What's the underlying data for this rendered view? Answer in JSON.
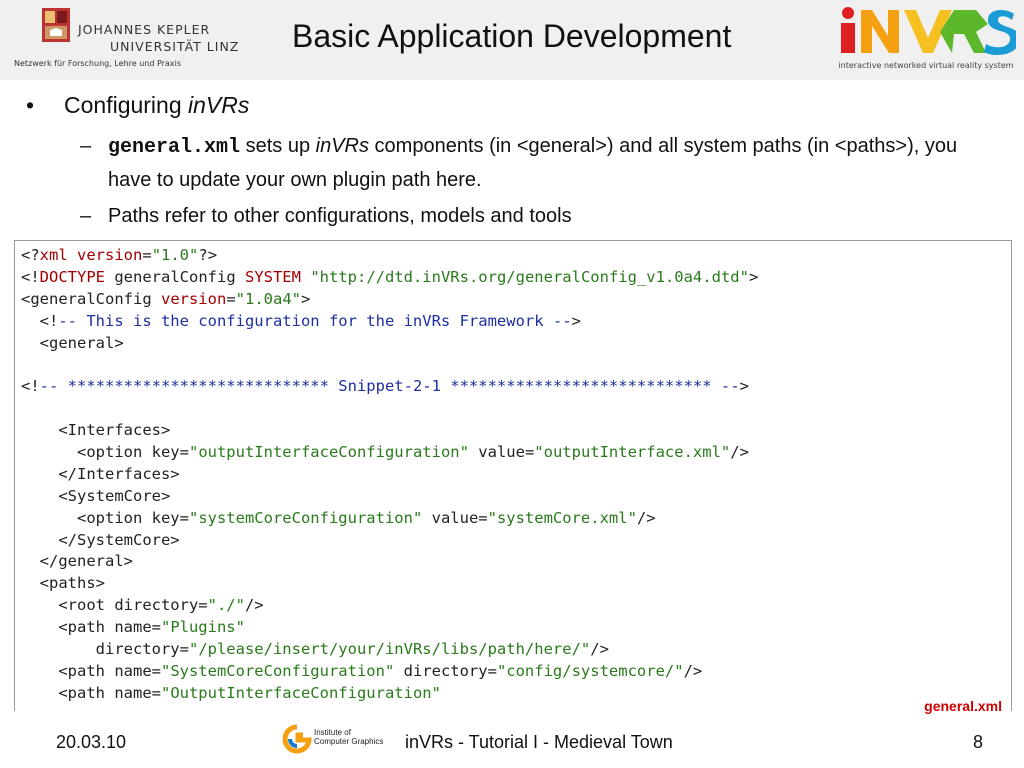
{
  "header": {
    "title": "Basic Application Development",
    "jku_line1": "JOHANNES KEPLER",
    "jku_line2": "UNIVERSITÄT LINZ",
    "jku_subtitle": "Netzwerk für Forschung, Lehre und Praxis",
    "invrs_logo": "iNVRS",
    "invrs_subtitle": "interactive networked virtual reality system"
  },
  "bullets": {
    "main_bullet": "•",
    "main_prefix": "Configuring ",
    "main_emph": "inVRs",
    "sub_dash": "–",
    "sub1": {
      "code": "general.xml",
      "t1": " sets up ",
      "emph": "inVRs",
      "t2": " components (in <general>) and all system paths (in <paths>), you have to update your own plugin path here."
    },
    "sub2": "Paths refer to other configurations, models and tools"
  },
  "code": {
    "lines": [
      [
        {
          "t": "<?"
        },
        {
          "t": "xml",
          "c": "k"
        },
        {
          "t": " "
        },
        {
          "t": "version",
          "c": "k"
        },
        {
          "t": "="
        },
        {
          "t": "\"1.0\"",
          "c": "s"
        },
        {
          "t": "?>"
        }
      ],
      [
        {
          "t": "<!"
        },
        {
          "t": "DOCTYPE",
          "c": "k"
        },
        {
          "t": " generalConfig "
        },
        {
          "t": "SYSTEM",
          "c": "k"
        },
        {
          "t": " "
        },
        {
          "t": "\"http://dtd.inVRs.org/generalConfig_v1.0a4.dtd\"",
          "c": "s"
        },
        {
          "t": ">"
        }
      ],
      [
        {
          "t": "<generalConfig "
        },
        {
          "t": "version",
          "c": "k"
        },
        {
          "t": "="
        },
        {
          "t": "\"1.0a4\"",
          "c": "s"
        },
        {
          "t": ">"
        }
      ],
      [
        {
          "t": "  <!"
        },
        {
          "t": "-- This is the configuration for the inVRs Framework --",
          "c": "c"
        },
        {
          "t": ">"
        }
      ],
      [
        {
          "t": "  <general>"
        }
      ],
      [
        {
          "t": ""
        }
      ],
      [
        {
          "t": "<!"
        },
        {
          "t": "-- **************************** Snippet-2-1 **************************** --",
          "c": "c"
        },
        {
          "t": ">"
        }
      ],
      [
        {
          "t": ""
        }
      ],
      [
        {
          "t": "    <Interfaces>"
        }
      ],
      [
        {
          "t": "      <option key="
        },
        {
          "t": "\"outputInterfaceConfiguration\"",
          "c": "s"
        },
        {
          "t": " value="
        },
        {
          "t": "\"outputInterface.xml\"",
          "c": "s"
        },
        {
          "t": "/>"
        }
      ],
      [
        {
          "t": "    </Interfaces>"
        }
      ],
      [
        {
          "t": "    <SystemCore>"
        }
      ],
      [
        {
          "t": "      <option key="
        },
        {
          "t": "\"systemCoreConfiguration\"",
          "c": "s"
        },
        {
          "t": " value="
        },
        {
          "t": "\"systemCore.xml\"",
          "c": "s"
        },
        {
          "t": "/>"
        }
      ],
      [
        {
          "t": "    </SystemCore>"
        }
      ],
      [
        {
          "t": "  </general>"
        }
      ],
      [
        {
          "t": "  <paths>"
        }
      ],
      [
        {
          "t": "    <root directory="
        },
        {
          "t": "\"./\"",
          "c": "s"
        },
        {
          "t": "/>"
        }
      ],
      [
        {
          "t": "    <path name="
        },
        {
          "t": "\"Plugins\"",
          "c": "s"
        }
      ],
      [
        {
          "t": "        directory="
        },
        {
          "t": "\"/please/insert/your/inVRs/libs/path/here/\"",
          "c": "s"
        },
        {
          "t": "/>"
        }
      ],
      [
        {
          "t": "    <path name="
        },
        {
          "t": "\"SystemCoreConfiguration\"",
          "c": "s"
        },
        {
          "t": " directory="
        },
        {
          "t": "\"config/systemcore/\"",
          "c": "s"
        },
        {
          "t": "/>"
        }
      ],
      [
        {
          "t": "    <path name="
        },
        {
          "t": "\"OutputInterfaceConfiguration\"",
          "c": "s"
        }
      ]
    ],
    "label": "general.xml"
  },
  "footer": {
    "date": "20.03.10",
    "logo_line1": "Institute of",
    "logo_line2": "Computer Graphics",
    "title": "inVRs - Tutorial I - Medieval Town",
    "page": "8"
  },
  "colors": {
    "keyword": "#a30000",
    "string": "#2a7a1c",
    "comment": "#1c2fa3",
    "label": "#cc0000",
    "header_bg": "#f0f0f0"
  }
}
